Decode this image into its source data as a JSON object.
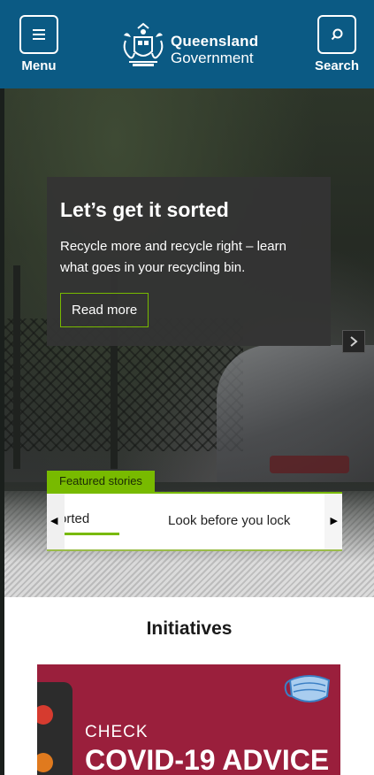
{
  "header": {
    "menu_label": "Menu",
    "search_label": "Search",
    "logo_line1": "Queensland",
    "logo_line2": "Government",
    "background_color": "#0b5a84"
  },
  "hero": {
    "title": "Let’s get it sorted",
    "text": "Recycle more and recycle right – learn what goes in your recycling bin.",
    "button_label": "Read more",
    "accent_color": "#78ba00",
    "next_icon": "chevron-right-icon"
  },
  "featured": {
    "tag_label": "Featured stories",
    "items": [
      {
        "label": "orted",
        "active": true
      },
      {
        "label": "Look before you lock",
        "active": false
      }
    ],
    "left_arrow": "◀",
    "right_arrow": "▶"
  },
  "initiatives": {
    "heading": "Initiatives",
    "card": {
      "check": "CHECK",
      "headline": "COVID-19 ADVICE",
      "background_color": "#9a1f3c"
    }
  }
}
